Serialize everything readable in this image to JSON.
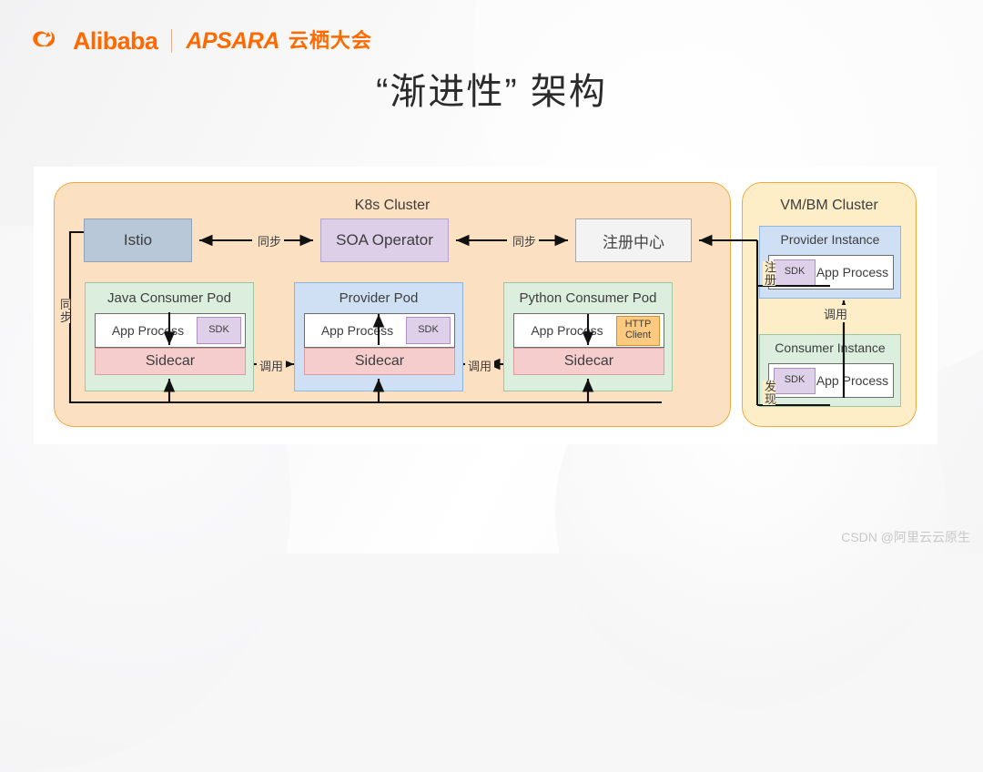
{
  "brand": {
    "alibaba": "Alibaba",
    "apsara": "APSARA",
    "apsara_cn": "云栖大会",
    "logo_icon": "alibaba-logo-icon",
    "accent_color": "#ff6a00"
  },
  "slide": {
    "title": "“渐进性” 架构"
  },
  "diagram": {
    "k8s_cluster": {
      "title": "K8s Cluster",
      "fill_color": "#fce0c2",
      "border_color": "#efa93c",
      "nodes": {
        "istio": {
          "label": "Istio",
          "fill_color": "#b8c8d8"
        },
        "soa_operator": {
          "label": "SOA Operator",
          "fill_color": "#ddcfe7"
        },
        "registry": {
          "label": "注册中心",
          "fill_color": "#f3f3f3"
        }
      },
      "pods": [
        {
          "title": "Java Consumer Pod",
          "fill_color": "#dceedd",
          "app_label": "App Process",
          "badge": {
            "line1": "SDK",
            "line2": "",
            "type": "sdk"
          },
          "sidecar": "Sidecar",
          "badge_arrow": "down"
        },
        {
          "title": "Provider Pod",
          "fill_color": "#cfe0f5",
          "app_label": "App Process",
          "badge": {
            "line1": "SDK",
            "line2": "",
            "type": "sdk"
          },
          "sidecar": "Sidecar",
          "badge_arrow": "up"
        },
        {
          "title": "Python Consumer Pod",
          "fill_color": "#dceedd",
          "app_label": "App Process",
          "badge": {
            "line1": "HTTP",
            "line2": "Client",
            "type": "http"
          },
          "sidecar": "Sidecar",
          "badge_arrow": "down"
        }
      ]
    },
    "vm_cluster": {
      "title": "VM/BM Cluster",
      "fill_color": "#fdeec8",
      "border_color": "#efa93c",
      "instances": [
        {
          "title": "Provider Instance",
          "fill_color": "#cfe0f5",
          "badge": "SDK",
          "app_label": "App Process"
        },
        {
          "title": "Consumer Instance",
          "fill_color": "#dceedd",
          "badge": "SDK",
          "app_label": "App Process"
        }
      ]
    },
    "edge_labels": {
      "sync_istio_soa": "同步",
      "sync_soa_registry": "同步",
      "sync_istio_sidecars": "同步",
      "call_java_to_provider": "调用",
      "call_python_to_provider": "调用",
      "register": "注册",
      "discover": "发现",
      "invoke_vm": "调用"
    }
  },
  "watermark": "CSDN @阿里云云原生"
}
